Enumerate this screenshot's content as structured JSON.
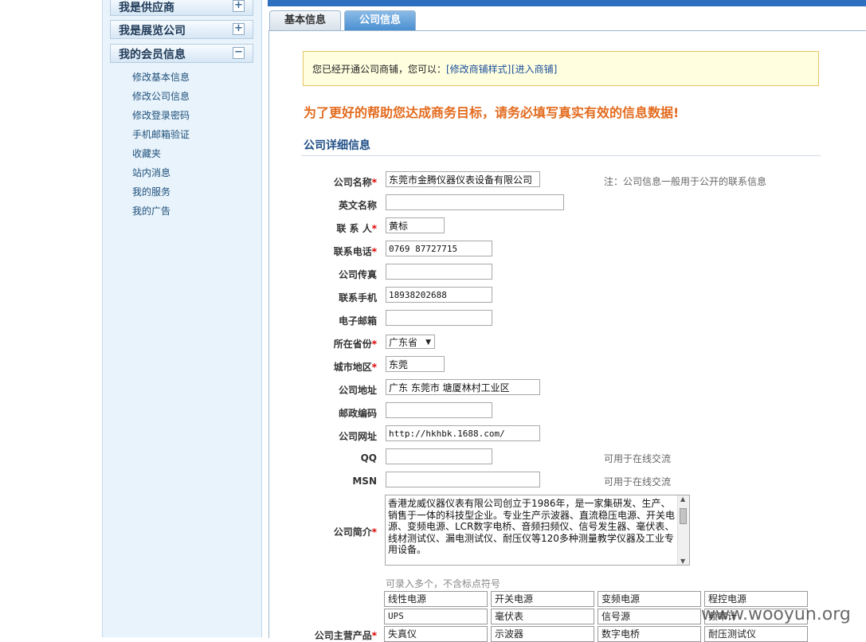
{
  "sidebar": {
    "categories": [
      {
        "label": "我是供应商",
        "toggle": "+"
      },
      {
        "label": "我是展览公司",
        "toggle": "+"
      },
      {
        "label": "我的会员信息",
        "toggle": "−"
      }
    ],
    "items": [
      "修改基本信息",
      "修改公司信息",
      "修改登录密码",
      "手机邮箱验证",
      "收藏夹",
      "站内消息",
      "我的服务",
      "我的广告"
    ]
  },
  "tabs": {
    "basic": "基本信息",
    "company": "公司信息"
  },
  "notice": {
    "text": "您已经开通公司商铺，您可以：",
    "link1": "[修改商铺样式]",
    "link2": "[进入商铺]"
  },
  "slogan": "为了更好的帮助您达成商务目标，请务必填写真实有效的信息数据!",
  "section_title": "公司详细信息",
  "fields": {
    "company_name": {
      "label": "公司名称",
      "value": "东莞市金腾仪器仪表设备有限公司",
      "note": "注：公司信息一般用于公开的联系信息"
    },
    "english_name": {
      "label": "英文名称",
      "value": ""
    },
    "contact": {
      "label": "联 系 人",
      "value": "黄标"
    },
    "phone": {
      "label": "联系电话",
      "value": "0769 87727715"
    },
    "fax": {
      "label": "公司传真",
      "value": ""
    },
    "mobile": {
      "label": "联系手机",
      "value": "18938202688"
    },
    "email": {
      "label": "电子邮箱",
      "value": ""
    },
    "province": {
      "label": "所在省份",
      "value": "广东省"
    },
    "city": {
      "label": "城市地区",
      "value": "东莞"
    },
    "address": {
      "label": "公司地址",
      "value": "广东 东莞市 塘厦林村工业区"
    },
    "zipcode": {
      "label": "邮政编码",
      "value": ""
    },
    "website": {
      "label": "公司网址",
      "value": "http://hkhbk.1688.com/"
    },
    "qq": {
      "label": "QQ",
      "value": "",
      "note": "可用于在线交流"
    },
    "msn": {
      "label": "MSN",
      "value": "",
      "note": "可用于在线交流"
    },
    "intro": {
      "label": "公司简介",
      "value": "香港龙威仪器仪表有限公司创立于1986年，是一家集研发、生产、销售于一体的科技型企业。专业生产示波器、直流稳压电源、开关电源、变频电源、LCR数字电桥、音频扫频仪、信号发生器、毫伏表、线材测试仪、漏电测试仪、耐压仪等120多种测量教学仪器及工业专用设备。"
    },
    "products": {
      "label": "公司主营产品",
      "hint": "可录入多个，不含标点符号",
      "items": [
        "线性电源",
        "开关电源",
        "变频电源",
        "程控电源",
        "UPS",
        "毫伏表",
        "信号源",
        "频率计",
        "失真仪",
        "示波器",
        "数字电桥",
        "耐压测试仪"
      ]
    }
  },
  "watermark": "www.wooyun.org"
}
